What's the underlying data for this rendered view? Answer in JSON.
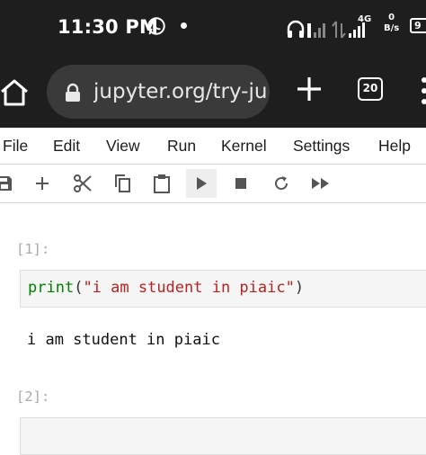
{
  "status_bar": {
    "time": "11:30 PM",
    "network": "4G",
    "speed_value": "0",
    "speed_unit": "B/s",
    "battery": "9"
  },
  "browser": {
    "url": "jupyter.org/try-jup",
    "tab_count": "20"
  },
  "menu": {
    "items": [
      "File",
      "Edit",
      "View",
      "Run",
      "Kernel",
      "Settings",
      "Help"
    ]
  },
  "toolbar": {
    "buttons": [
      "save-icon",
      "add-cell-icon",
      "cut-icon",
      "copy-icon",
      "paste-icon",
      "run-icon",
      "stop-icon",
      "restart-icon",
      "fast-forward-icon"
    ]
  },
  "cells": [
    {
      "prompt": "[1]:",
      "code": {
        "func": "print",
        "open": "(",
        "string": "\"i am student in piaic\"",
        "close": ")"
      },
      "output": "i am student in piaic"
    },
    {
      "prompt": "[2]:"
    }
  ],
  "colors": {
    "status_bg": "#1e1e1e",
    "url_bg": "#3a3a3a",
    "keyword": "#008000",
    "string": "#ba2121",
    "prompt": "#aaaaaa"
  }
}
